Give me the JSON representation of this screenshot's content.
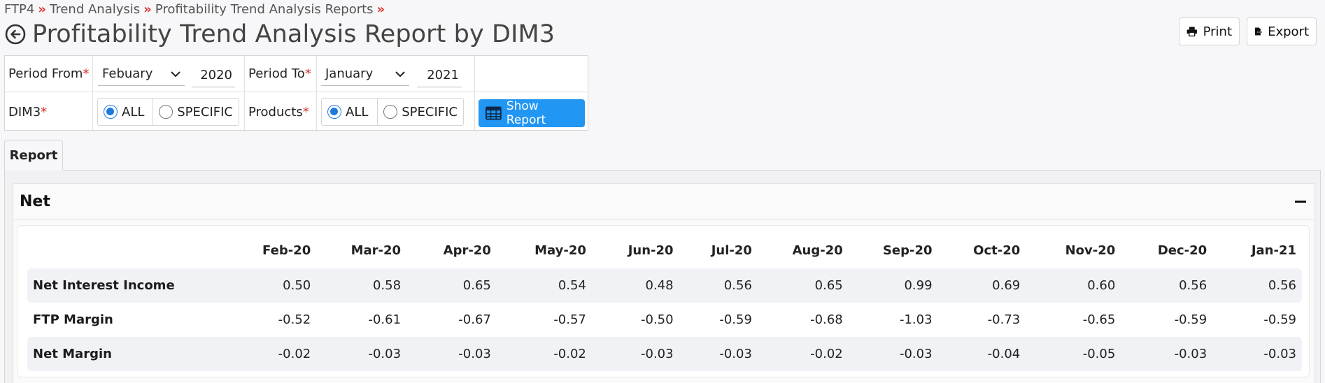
{
  "breadcrumb": {
    "items": [
      "FTP4",
      "Trend Analysis",
      "Profitability Trend Analysis Reports"
    ],
    "separator": "»"
  },
  "page": {
    "title": "Profitability Trend Analysis Report by DIM3"
  },
  "toolbar": {
    "print_label": "Print",
    "export_label": "Export"
  },
  "filters": {
    "period_from": {
      "label": "Period From",
      "required": "*",
      "month": "Febuary",
      "year": "2020"
    },
    "period_to": {
      "label": "Period To",
      "required": "*",
      "month": "January",
      "year": "2021"
    },
    "dim3": {
      "label": "DIM3",
      "required": "*",
      "options": [
        "ALL",
        "SPECIFIC"
      ],
      "selected": "ALL"
    },
    "products": {
      "label": "Products",
      "required": "*",
      "options": [
        "ALL",
        "SPECIFIC"
      ],
      "selected": "ALL"
    },
    "show_report_label": "Show Report"
  },
  "tabs": [
    {
      "label": "Report",
      "active": true
    }
  ],
  "net_section": {
    "title": "Net",
    "columns": [
      "Feb-20",
      "Mar-20",
      "Apr-20",
      "May-20",
      "Jun-20",
      "Jul-20",
      "Aug-20",
      "Sep-20",
      "Oct-20",
      "Nov-20",
      "Dec-20",
      "Jan-21"
    ],
    "rows": [
      {
        "label": "Net Interest Income",
        "values": [
          "0.50",
          "0.58",
          "0.65",
          "0.54",
          "0.48",
          "0.56",
          "0.65",
          "0.99",
          "0.69",
          "0.60",
          "0.56",
          "0.56"
        ]
      },
      {
        "label": "FTP Margin",
        "values": [
          "-0.52",
          "-0.61",
          "-0.67",
          "-0.57",
          "-0.50",
          "-0.59",
          "-0.68",
          "-1.03",
          "-0.73",
          "-0.65",
          "-0.59",
          "-0.59"
        ]
      },
      {
        "label": "Net Margin",
        "values": [
          "-0.02",
          "-0.03",
          "-0.03",
          "-0.02",
          "-0.03",
          "-0.03",
          "-0.02",
          "-0.03",
          "-0.04",
          "-0.05",
          "-0.03",
          "-0.03"
        ]
      }
    ]
  },
  "colors": {
    "accent": "#2196f3",
    "required": "#d9342b",
    "radio_checked": "#1f7ae0"
  }
}
